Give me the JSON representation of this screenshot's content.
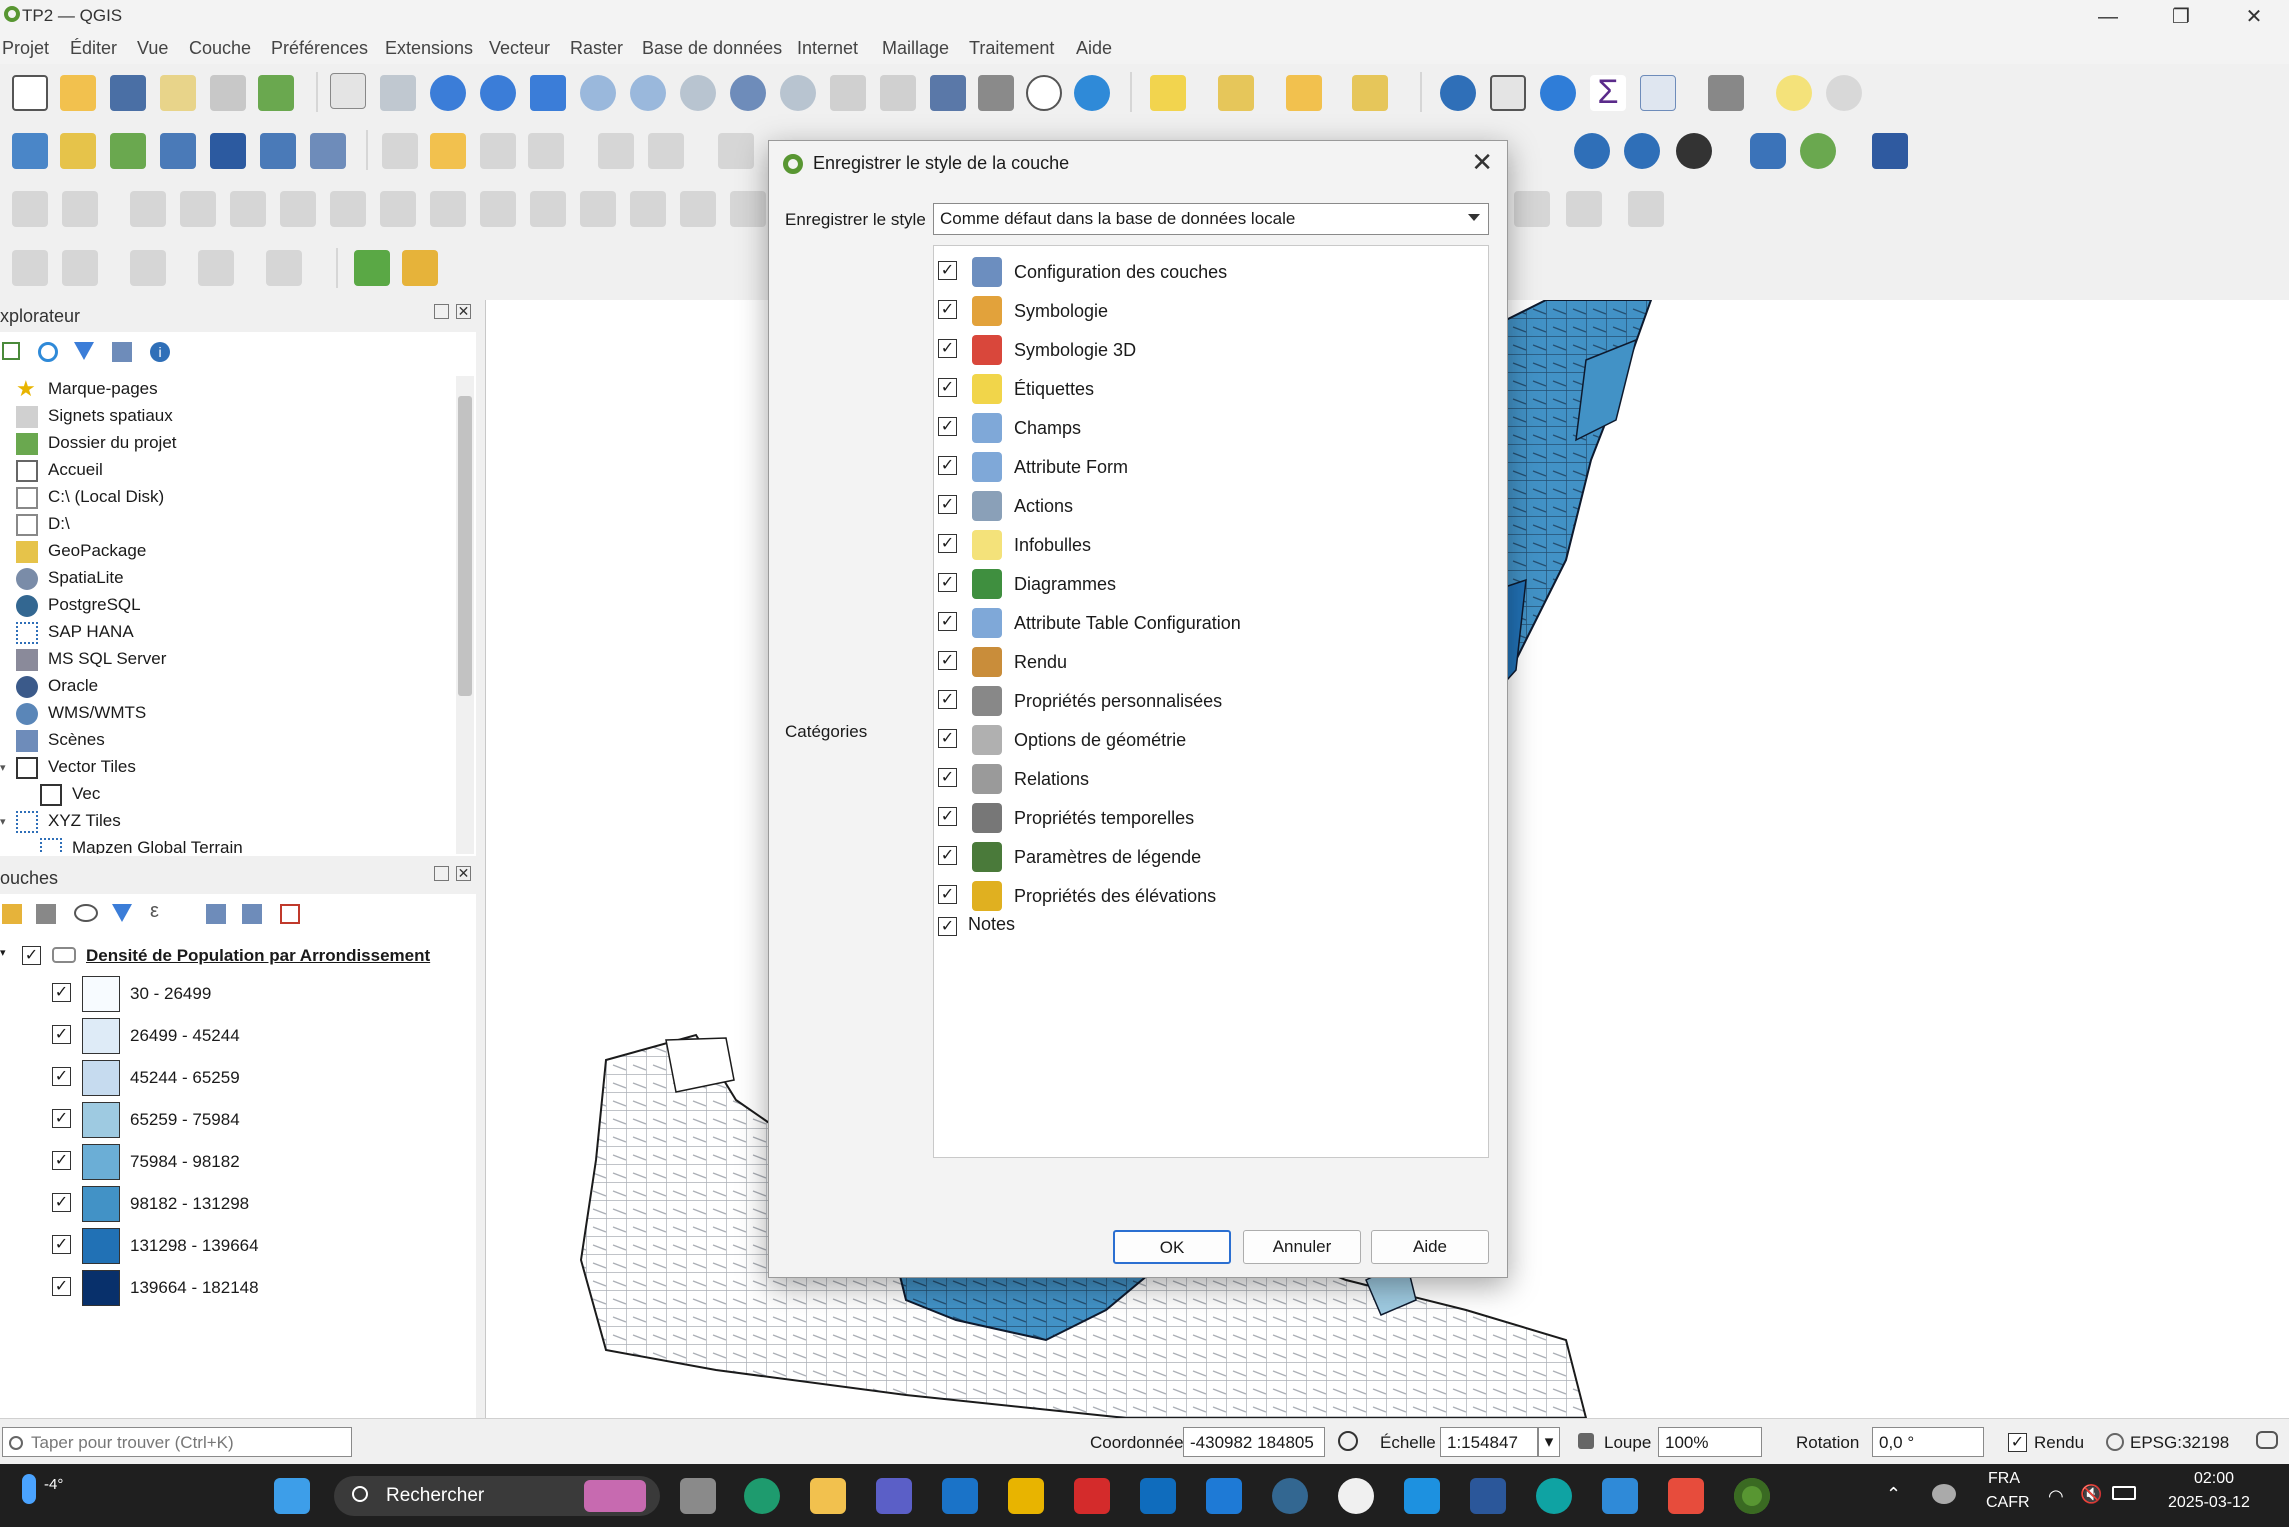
{
  "window": {
    "title": "TP2 — QGIS",
    "controls": [
      "—",
      "❐",
      "✕"
    ]
  },
  "menu": [
    "Projet",
    "Éditer",
    "Vue",
    "Couche",
    "Préférences",
    "Extensions",
    "Vecteur",
    "Raster",
    "Base de données",
    "Internet",
    "Maillage",
    "Traitement",
    "Aide"
  ],
  "browser": {
    "title": "xplorateur",
    "items": [
      {
        "label": "Marque-pages",
        "icon": "star-icon"
      },
      {
        "label": "Signets spatiaux",
        "icon": "bookmark-icon"
      },
      {
        "label": "Dossier du projet",
        "icon": "project-folder-icon"
      },
      {
        "label": "Accueil",
        "icon": "home-icon"
      },
      {
        "label": "C:\\ (Local Disk)",
        "icon": "folder-icon"
      },
      {
        "label": "D:\\",
        "icon": "folder-icon"
      },
      {
        "label": "GeoPackage",
        "icon": "geopackage-icon"
      },
      {
        "label": "SpatiaLite",
        "icon": "spatialite-icon"
      },
      {
        "label": "PostgreSQL",
        "icon": "postgresql-icon"
      },
      {
        "label": "SAP HANA",
        "icon": "sap-hana-icon"
      },
      {
        "label": "MS SQL Server",
        "icon": "mssql-icon"
      },
      {
        "label": "Oracle",
        "icon": "oracle-icon"
      },
      {
        "label": "WMS/WMTS",
        "icon": "globe-icon"
      },
      {
        "label": "Scènes",
        "icon": "scene-icon"
      },
      {
        "label": "Vector Tiles",
        "icon": "grid-icon"
      },
      {
        "label": "Vec",
        "icon": "grid-icon"
      },
      {
        "label": "XYZ Tiles",
        "icon": "xyz-grid-icon"
      },
      {
        "label": "Mapzen Global Terrain",
        "icon": "xyz-grid-icon"
      }
    ]
  },
  "layers": {
    "title": "ouches",
    "layer_name": "Densité de Population par Arrondissement",
    "classes": [
      {
        "label": "30 - 26499",
        "color": "#f7fbff"
      },
      {
        "label": "26499 - 45244",
        "color": "#deebf7"
      },
      {
        "label": "45244 - 65259",
        "color": "#c6dbef"
      },
      {
        "label": "65259 - 75984",
        "color": "#9ecae1"
      },
      {
        "label": "75984 - 98182",
        "color": "#6baed6"
      },
      {
        "label": "98182 - 131298",
        "color": "#4292c6"
      },
      {
        "label": "131298 - 139664",
        "color": "#2171b5"
      },
      {
        "label": "139664 - 182148",
        "color": "#08306b"
      }
    ]
  },
  "dialog": {
    "title": "Enregistrer le style de la couche",
    "save_label": "Enregistrer le style",
    "save_value": "Comme défaut dans la base de données locale",
    "categories_label": "Catégories",
    "categories": [
      {
        "label": "Configuration des couches",
        "icon": "layer-config-icon",
        "color": "#6c8ebf"
      },
      {
        "label": "Symbologie",
        "icon": "symbology-brush-icon",
        "color": "#e2a23b"
      },
      {
        "label": "Symbologie 3D",
        "icon": "cube-3d-icon",
        "color": "#d9473b"
      },
      {
        "label": "Étiquettes",
        "icon": "labels-abc-icon",
        "color": "#f1d54a"
      },
      {
        "label": "Champs",
        "icon": "fields-icon",
        "color": "#7fa8d8"
      },
      {
        "label": "Attribute Form",
        "icon": "attribute-form-icon",
        "color": "#7fa8d8"
      },
      {
        "label": "Actions",
        "icon": "actions-gear-icon",
        "color": "#8aa0b8"
      },
      {
        "label": "Infobulles",
        "icon": "tooltip-bubble-icon",
        "color": "#f4e27a"
      },
      {
        "label": "Diagrammes",
        "icon": "diagram-icon",
        "color": "#3f8f3f"
      },
      {
        "label": "Attribute Table Configuration",
        "icon": "table-config-icon",
        "color": "#7fa8d8"
      },
      {
        "label": "Rendu",
        "icon": "rendering-brush-icon",
        "color": "#c98d3a"
      },
      {
        "label": "Propriétés personnalisées",
        "icon": "wrench-icon",
        "color": "#888888"
      },
      {
        "label": "Options de géométrie",
        "icon": "geometry-options-icon",
        "color": "#b0b0b0"
      },
      {
        "label": "Relations",
        "icon": "relations-icon",
        "color": "#9a9a9a"
      },
      {
        "label": "Propriétés temporelles",
        "icon": "clock-icon",
        "color": "#777777"
      },
      {
        "label": "Paramètres de légende",
        "icon": "legend-icon",
        "color": "#4a7a3a"
      },
      {
        "label": "Propriétés des élévations",
        "icon": "elevation-icon",
        "color": "#e0b020"
      },
      {
        "label": "Notes",
        "icon": "",
        "color": ""
      }
    ],
    "buttons": {
      "ok": "OK",
      "cancel": "Annuler",
      "help": "Aide"
    }
  },
  "statusbar": {
    "locator_placeholder": "Taper pour trouver (Ctrl+K)",
    "coordinate_label": "Coordonnée",
    "coordinate_value": "-430982  184805",
    "scale_label": "Échelle",
    "scale_value": "1:154847",
    "magnifier_label": "Loupe",
    "magnifier_value": "100%",
    "rotation_label": "Rotation",
    "rotation_value": "0,0 °",
    "render_label": "Rendu",
    "crs": "EPSG:32198"
  },
  "taskbar": {
    "weather": "-4°",
    "search_label": "Rechercher",
    "language": "FRA",
    "layout": "CAFR",
    "time": "02:00",
    "date": "2025-03-12"
  }
}
